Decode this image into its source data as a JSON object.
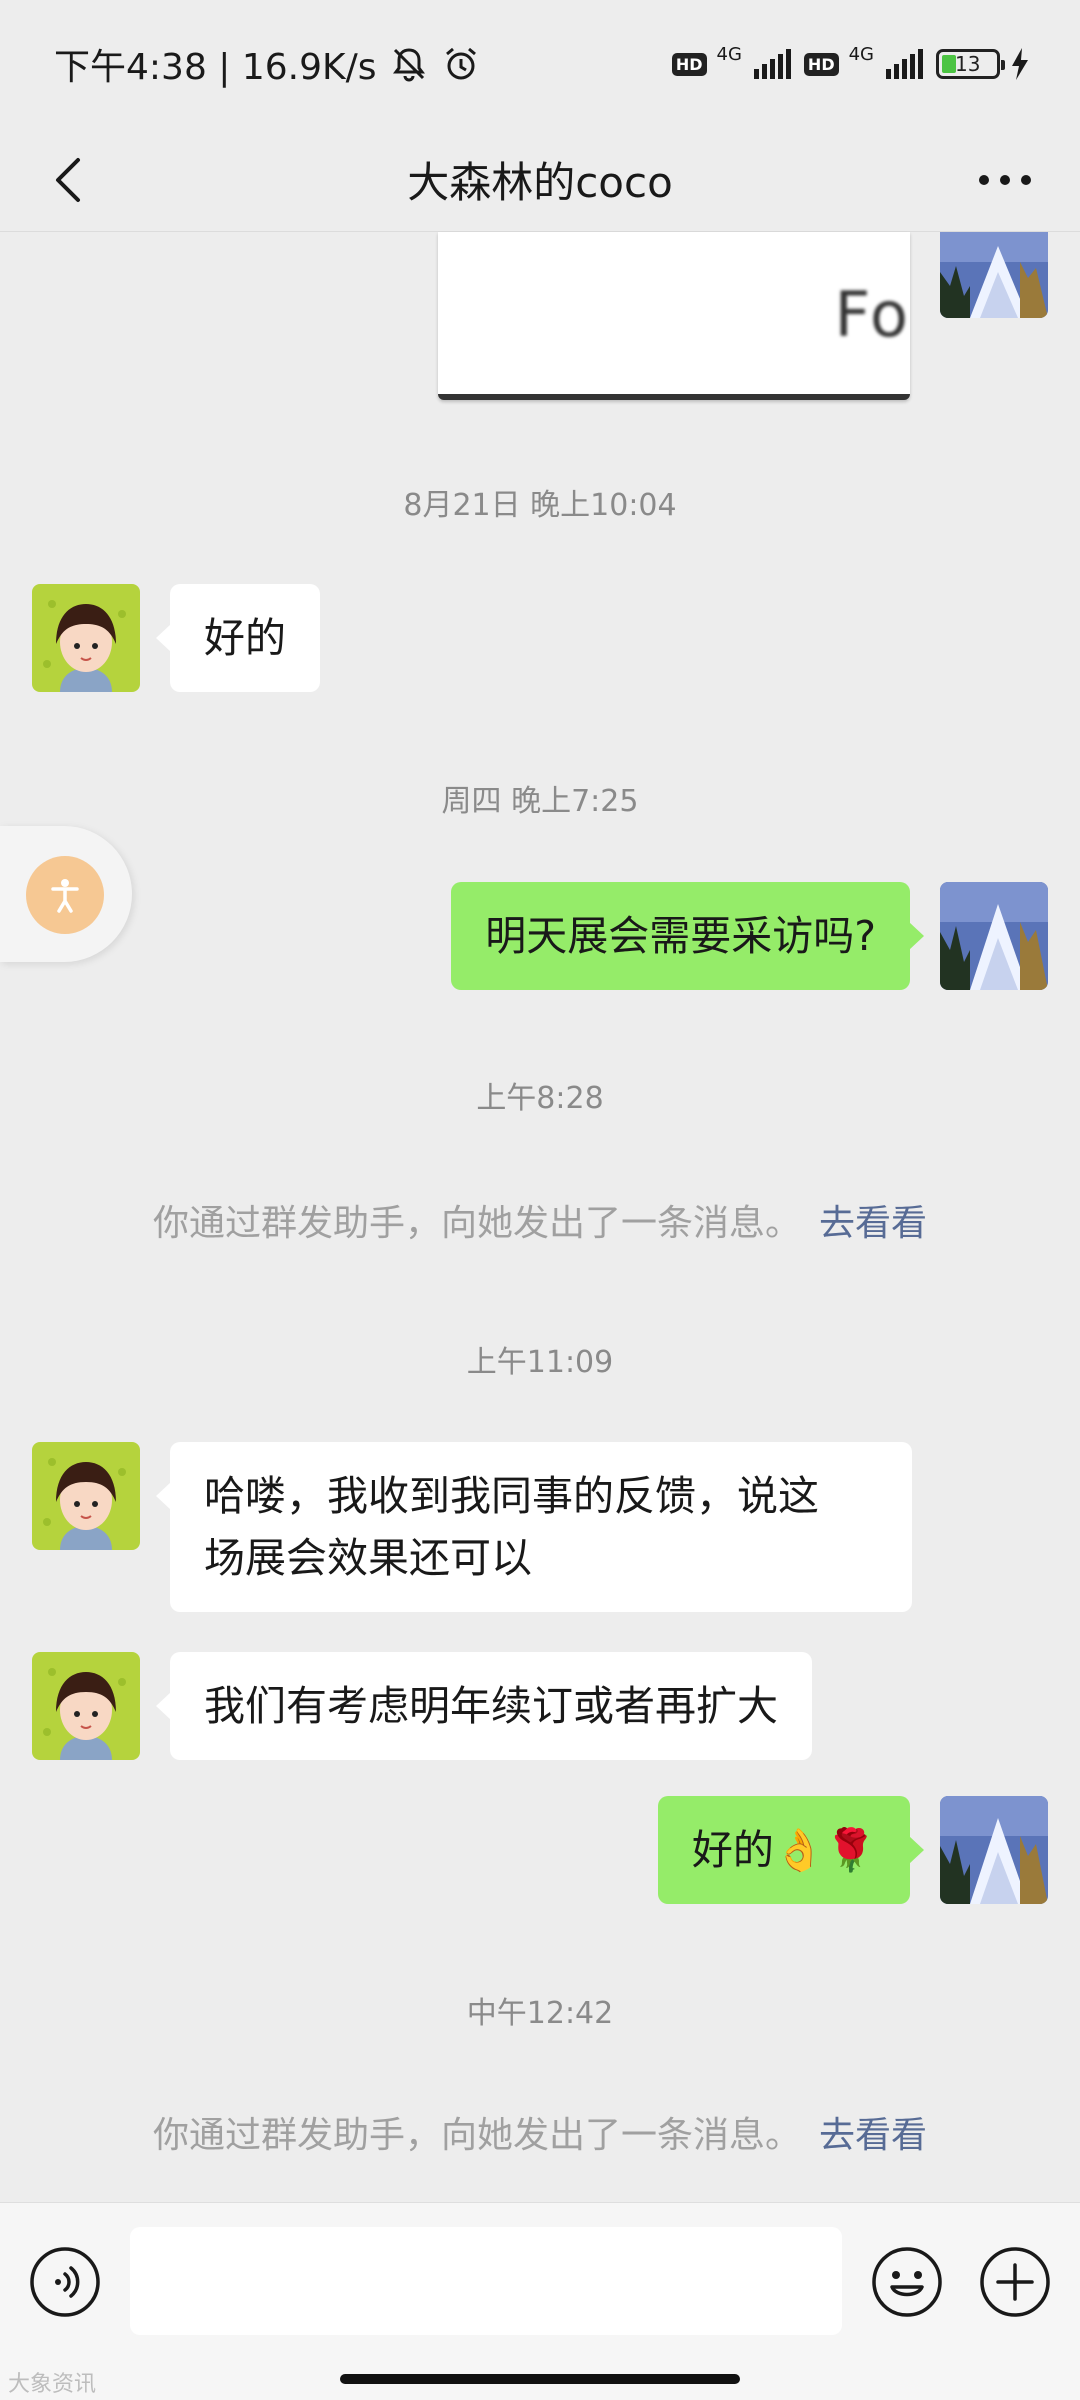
{
  "status_bar": {
    "time_speed": "下午4:38 | 16.9K/s",
    "hd_label": "HD",
    "network": "4G",
    "battery_level": "13"
  },
  "nav": {
    "title": "大森林的coco"
  },
  "cut_card": {
    "text": "Fo"
  },
  "messages": {
    "ts1": "8月21日 晚上10:04",
    "m1": "好的",
    "ts2": "周四 晚上7:25",
    "m2": "明天展会需要采访吗?",
    "ts3": "上午8:28",
    "sys1": "你通过群发助手，向她发出了一条消息。",
    "sys1_link": "去看看",
    "ts4": "上午11:09",
    "m3_line1": "哈喽，我收到我同事的反馈，说这",
    "m3_line2": "场展会效果还可以",
    "m4": "我们有考虑明年续订或者再扩大",
    "m5": "好的👌🌹",
    "ts5": "中午12:42",
    "sys2": "你通过群发助手，向她发出了一条消息。",
    "sys2_link": "去看看"
  },
  "input": {
    "placeholder": ""
  },
  "watermark": "大象资讯"
}
